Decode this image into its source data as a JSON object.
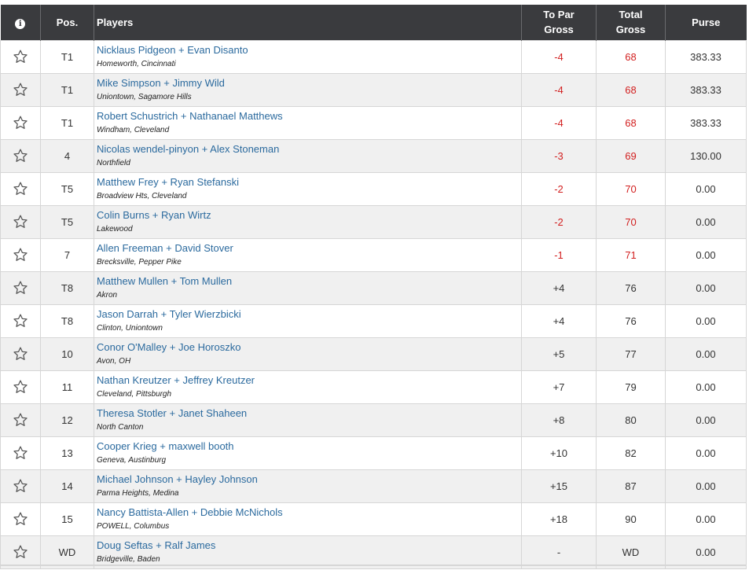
{
  "colors": {
    "header_bg": "#3a3b3e",
    "link": "#2b6a9e",
    "under_par": "#d21f1f",
    "row_alt": "#f0f0f0"
  },
  "header": {
    "info_icon": "info-icon",
    "pos": "Pos.",
    "players": "Players",
    "to_par_line1": "To Par",
    "to_par_line2": "Gross",
    "total_line1": "Total",
    "total_line2": "Gross",
    "purse": "Purse"
  },
  "rows": [
    {
      "pos": "T1",
      "name": "Nicklaus Pidgeon + Evan Disanto",
      "loc": "Homeworth, Cincinnati",
      "to_par": "-4",
      "total": "68",
      "purse": "383.33",
      "under": true
    },
    {
      "pos": "T1",
      "name": "Mike Simpson + Jimmy Wild",
      "loc": "Uniontown, Sagamore Hills",
      "to_par": "-4",
      "total": "68",
      "purse": "383.33",
      "under": true
    },
    {
      "pos": "T1",
      "name": "Robert Schustrich + Nathanael Matthews",
      "loc": "Windham, Cleveland",
      "to_par": "-4",
      "total": "68",
      "purse": "383.33",
      "under": true
    },
    {
      "pos": "4",
      "name": "Nicolas wendel-pinyon + Alex Stoneman",
      "loc": "Northfield",
      "to_par": "-3",
      "total": "69",
      "purse": "130.00",
      "under": true
    },
    {
      "pos": "T5",
      "name": "Matthew Frey + Ryan Stefanski",
      "loc": "Broadview Hts, Cleveland",
      "to_par": "-2",
      "total": "70",
      "purse": "0.00",
      "under": true
    },
    {
      "pos": "T5",
      "name": "Colin Burns + Ryan Wirtz",
      "loc": "Lakewood",
      "to_par": "-2",
      "total": "70",
      "purse": "0.00",
      "under": true
    },
    {
      "pos": "7",
      "name": "Allen Freeman + David Stover",
      "loc": "Brecksville, Pepper Pike",
      "to_par": "-1",
      "total": "71",
      "purse": "0.00",
      "under": true
    },
    {
      "pos": "T8",
      "name": "Matthew Mullen + Tom Mullen",
      "loc": "Akron",
      "to_par": "+4",
      "total": "76",
      "purse": "0.00",
      "under": false
    },
    {
      "pos": "T8",
      "name": "Jason Darrah + Tyler Wierzbicki",
      "loc": "Clinton, Uniontown",
      "to_par": "+4",
      "total": "76",
      "purse": "0.00",
      "under": false
    },
    {
      "pos": "10",
      "name": "Conor O'Malley + Joe Horoszko",
      "loc": "Avon, OH",
      "to_par": "+5",
      "total": "77",
      "purse": "0.00",
      "under": false
    },
    {
      "pos": "11",
      "name": "Nathan Kreutzer + Jeffrey Kreutzer",
      "loc": "Cleveland, Pittsburgh",
      "to_par": "+7",
      "total": "79",
      "purse": "0.00",
      "under": false
    },
    {
      "pos": "12",
      "name": "Theresa Stotler + Janet Shaheen",
      "loc": "North Canton",
      "to_par": "+8",
      "total": "80",
      "purse": "0.00",
      "under": false
    },
    {
      "pos": "13",
      "name": "Cooper Krieg + maxwell booth",
      "loc": "Geneva, Austinburg",
      "to_par": "+10",
      "total": "82",
      "purse": "0.00",
      "under": false
    },
    {
      "pos": "14",
      "name": "Michael Johnson + Hayley Johnson",
      "loc": "Parma Heights, Medina",
      "to_par": "+15",
      "total": "87",
      "purse": "0.00",
      "under": false
    },
    {
      "pos": "15",
      "name": "Nancy Battista-Allen + Debbie McNichols",
      "loc": "POWELL, Columbus",
      "to_par": "+18",
      "total": "90",
      "purse": "0.00",
      "under": false
    },
    {
      "pos": "WD",
      "name": "Doug Seftas + Ralf James",
      "loc": "Bridgeville, Baden",
      "to_par": "-",
      "total": "WD",
      "purse": "0.00",
      "under": false
    }
  ]
}
